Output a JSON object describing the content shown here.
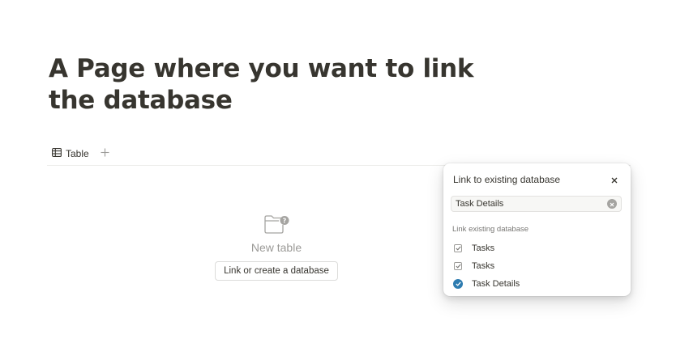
{
  "page": {
    "title": "A Page where you want to link the database"
  },
  "views": {
    "tabs": [
      {
        "label": "Table",
        "icon": "table-icon"
      }
    ],
    "add_icon": "plus-icon"
  },
  "empty_state": {
    "icon": "folder-question-icon",
    "title": "New table",
    "action_label": "Link or create a database"
  },
  "link_popover": {
    "title": "Link to existing database",
    "search": {
      "value": "Task Details",
      "placeholder": ""
    },
    "section_label": "Link existing database",
    "items": [
      {
        "label": "Tasks",
        "state": "checkbox"
      },
      {
        "label": "Tasks",
        "state": "checkbox"
      },
      {
        "label": "Task Details",
        "state": "selected"
      }
    ]
  },
  "colors": {
    "text": "#37352f",
    "muted": "#9b9a97",
    "accent": "#2e7cb0",
    "border": "#ededeb"
  }
}
